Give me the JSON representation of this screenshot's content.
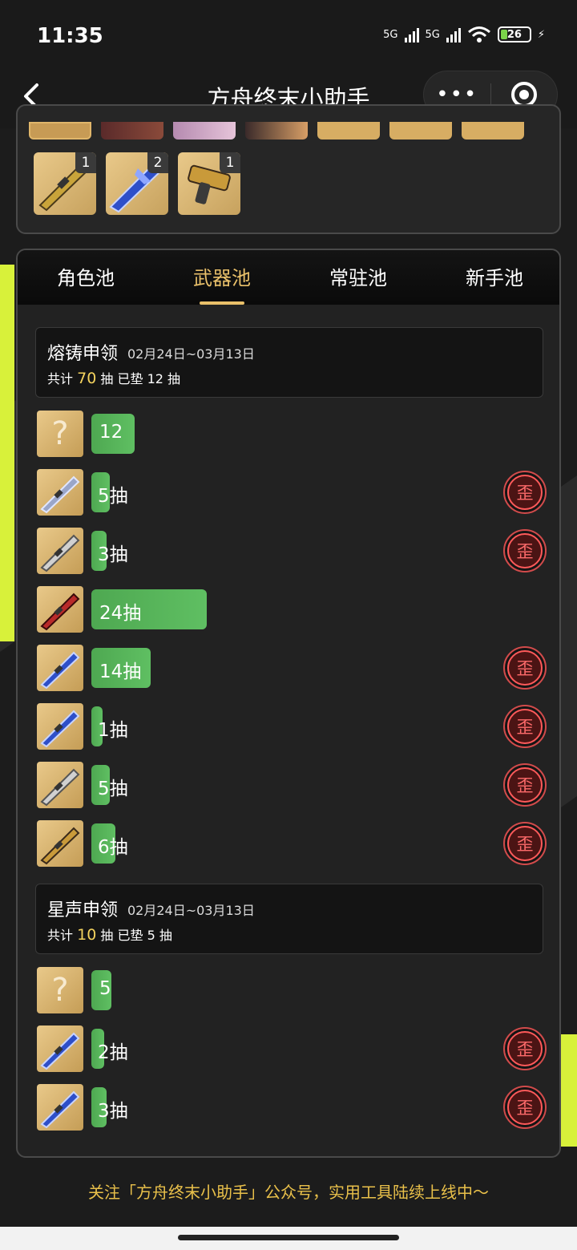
{
  "status_bar": {
    "time": "11:35",
    "net1": "5G",
    "net2": "5G",
    "battery": "26"
  },
  "nav": {
    "title": "方舟终末小助手",
    "more_label": "•••"
  },
  "top_card": {
    "weapon_counts": [
      "1",
      "2",
      "1"
    ]
  },
  "tabs": [
    {
      "label": "角色池"
    },
    {
      "label": "武器池"
    },
    {
      "label": "常驻池"
    },
    {
      "label": "新手池"
    }
  ],
  "pools": [
    {
      "name": "熔铸申领",
      "date": "02月24日~03月13日",
      "stats_prefix": "共计",
      "total": "70",
      "stats_mid": "抽  已垫",
      "pity": "12",
      "stats_suffix": "抽",
      "pulls": [
        {
          "text": "12",
          "bar": 0.19,
          "waai": false,
          "unknown": true
        },
        {
          "text": "5抽",
          "bar": 0.05,
          "waai": true
        },
        {
          "text": "3抽",
          "bar": 0.03,
          "waai": true
        },
        {
          "text": "24抽",
          "bar": 0.6,
          "waai": false
        },
        {
          "text": "14抽",
          "bar": 0.28,
          "waai": true
        },
        {
          "text": "1抽",
          "bar": 0.01,
          "waai": true
        },
        {
          "text": "5抽",
          "bar": 0.05,
          "waai": true
        },
        {
          "text": "6抽",
          "bar": 0.08,
          "waai": true
        }
      ]
    },
    {
      "name": "星声申领",
      "date": "02月24日~03月13日",
      "stats_prefix": "共计",
      "total": "10",
      "stats_mid": "抽  已垫",
      "pity": "5",
      "stats_suffix": "抽",
      "pulls": [
        {
          "text": "5",
          "bar": 0.06,
          "waai": false,
          "unknown": true
        },
        {
          "text": "2抽",
          "bar": 0.02,
          "waai": true
        },
        {
          "text": "3抽",
          "bar": 0.03,
          "waai": true
        }
      ]
    }
  ],
  "waai_label": "歪",
  "footer": "关注「方舟终末小助手」公众号，实用工具陆续上线中～",
  "colors": {
    "accent": "#e9c06a",
    "bar": "#5fbf62",
    "neon": "#d8f13a",
    "waai": "#ff5a5a"
  }
}
